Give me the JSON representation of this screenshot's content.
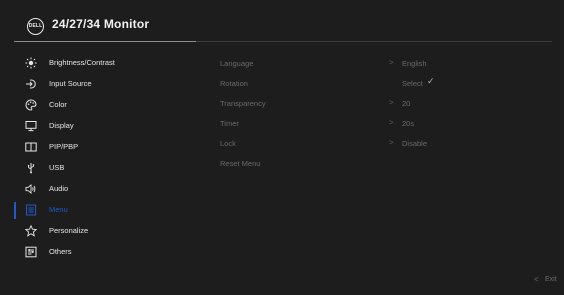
{
  "header": {
    "logo_text": "DELL",
    "title": "24/27/34 Monitor"
  },
  "menu": {
    "items": [
      {
        "label": "Brightness/Contrast",
        "icon": "brightness-icon"
      },
      {
        "label": "Input Source",
        "icon": "input-source-icon"
      },
      {
        "label": "Color",
        "icon": "color-palette-icon"
      },
      {
        "label": "Display",
        "icon": "display-icon"
      },
      {
        "label": "PIP/PBP",
        "icon": "pip-pbp-icon"
      },
      {
        "label": "USB",
        "icon": "usb-icon"
      },
      {
        "label": "Audio",
        "icon": "audio-icon"
      },
      {
        "label": "Menu",
        "icon": "menu-icon"
      },
      {
        "label": "Personalize",
        "icon": "star-icon"
      },
      {
        "label": "Others",
        "icon": "others-icon"
      }
    ],
    "active": "Menu"
  },
  "submenu": {
    "items": [
      {
        "label": "Language",
        "arrow": ">",
        "value": "English"
      },
      {
        "label": "Rotation",
        "value": "Select",
        "check": "✓"
      },
      {
        "label": "Transparency",
        "arrow": ">",
        "value": "20"
      },
      {
        "label": "Timer",
        "arrow": ">",
        "value": "20s"
      },
      {
        "label": "Lock",
        "arrow": ">",
        "value": "Disable"
      },
      {
        "label": "Reset Menu"
      }
    ]
  },
  "footer": {
    "exit_arrow": "<",
    "exit_label": "Exit"
  },
  "colors": {
    "accent": "#1f5ac8",
    "background": "#1d1d1d",
    "text": "#e6e6e6",
    "dim_text": "#6a6a6a"
  }
}
